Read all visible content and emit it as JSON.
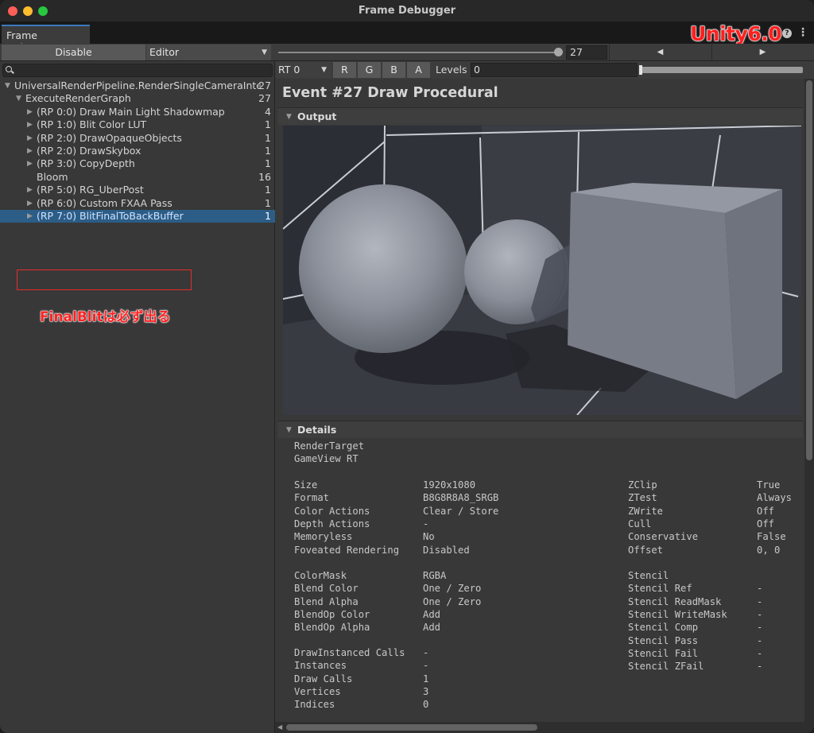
{
  "window": {
    "title": "Frame Debugger"
  },
  "tab": {
    "label": "Frame Debugger"
  },
  "annotation": {
    "badge": "Unity6.0",
    "note": "FinalBlitは必ず出る"
  },
  "toolbar": {
    "disable_label": "Disable",
    "target_selected": "Editor",
    "event_value": "27",
    "event_max": 27,
    "prev_glyph": "◀",
    "next_glyph": "▶"
  },
  "tree": [
    {
      "label": "UniversalRenderPipeline.RenderSingleCameraInternal",
      "count": "27",
      "depth": 0,
      "expanded": true
    },
    {
      "label": "ExecuteRenderGraph",
      "count": "27",
      "depth": 1,
      "expanded": true
    },
    {
      "label": "(RP 0:0) Draw Main Light Shadowmap",
      "count": "4",
      "depth": 2,
      "expanded": false
    },
    {
      "label": "(RP 1:0) Blit Color LUT",
      "count": "1",
      "depth": 2,
      "expanded": false
    },
    {
      "label": "(RP 2:0) DrawOpaqueObjects",
      "count": "1",
      "depth": 2,
      "expanded": false
    },
    {
      "label": "(RP 2:0) DrawSkybox",
      "count": "1",
      "depth": 2,
      "expanded": false
    },
    {
      "label": "(RP 3:0) CopyDepth",
      "count": "1",
      "depth": 2,
      "expanded": false
    },
    {
      "label": "Bloom",
      "count": "16",
      "depth": 2,
      "expanded": null
    },
    {
      "label": "(RP 5:0) RG_UberPost",
      "count": "1",
      "depth": 2,
      "expanded": false
    },
    {
      "label": "(RP 6:0) Custom FXAA Pass",
      "count": "1",
      "depth": 2,
      "expanded": false
    },
    {
      "label": "(RP 7:0) BlitFinalToBackBuffer",
      "count": "1",
      "depth": 2,
      "expanded": false,
      "selected": true
    }
  ],
  "rtbar": {
    "rt_selected": "RT 0",
    "channels": [
      "R",
      "G",
      "B",
      "A"
    ],
    "levels_label": "Levels",
    "levels_value": "0"
  },
  "event": {
    "title": "Event #27 Draw Procedural"
  },
  "sections": {
    "output": "Output",
    "details": "Details"
  },
  "details": {
    "render_target": {
      "label": "RenderTarget",
      "value": "GameView RT"
    },
    "left_group1": [
      {
        "k": "Size",
        "v": "1920x1080"
      },
      {
        "k": "Format",
        "v": "B8G8R8A8_SRGB"
      },
      {
        "k": "Color Actions",
        "v": "Clear / Store"
      },
      {
        "k": "Depth Actions",
        "v": "-"
      },
      {
        "k": "Memoryless",
        "v": "No"
      },
      {
        "k": "Foveated Rendering",
        "v": "Disabled"
      }
    ],
    "right_group1": [
      {
        "k": "ZClip",
        "v": "True"
      },
      {
        "k": "ZTest",
        "v": "Always"
      },
      {
        "k": "ZWrite",
        "v": "Off"
      },
      {
        "k": "Cull",
        "v": "Off"
      },
      {
        "k": "Conservative",
        "v": "False"
      },
      {
        "k": "Offset",
        "v": "0, 0"
      }
    ],
    "left_group2": [
      {
        "k": "ColorMask",
        "v": "RGBA"
      },
      {
        "k": "Blend Color",
        "v": "One / Zero"
      },
      {
        "k": "Blend Alpha",
        "v": "One / Zero"
      },
      {
        "k": "BlendOp Color",
        "v": "Add"
      },
      {
        "k": "BlendOp Alpha",
        "v": "Add"
      }
    ],
    "right_group2": [
      {
        "k": "Stencil",
        "v": ""
      },
      {
        "k": "Stencil Ref",
        "v": "-"
      },
      {
        "k": "Stencil ReadMask",
        "v": "-"
      },
      {
        "k": "Stencil WriteMask",
        "v": "-"
      },
      {
        "k": "Stencil Comp",
        "v": "-"
      },
      {
        "k": "Stencil Pass",
        "v": "-"
      },
      {
        "k": "Stencil Fail",
        "v": "-"
      },
      {
        "k": "Stencil ZFail",
        "v": "-"
      }
    ],
    "left_group3": [
      {
        "k": "DrawInstanced Calls",
        "v": "-"
      },
      {
        "k": "Instances",
        "v": "-"
      },
      {
        "k": "Draw Calls",
        "v": "1"
      },
      {
        "k": "Vertices",
        "v": "3"
      },
      {
        "k": "Indices",
        "v": "0"
      }
    ]
  },
  "colors": {
    "accent": "#3a79bb",
    "selection": "#2c5d87",
    "annotation_red": "#ff2121"
  },
  "icons": {
    "help": "help-icon",
    "more": "more-icon",
    "search": "search-icon"
  }
}
